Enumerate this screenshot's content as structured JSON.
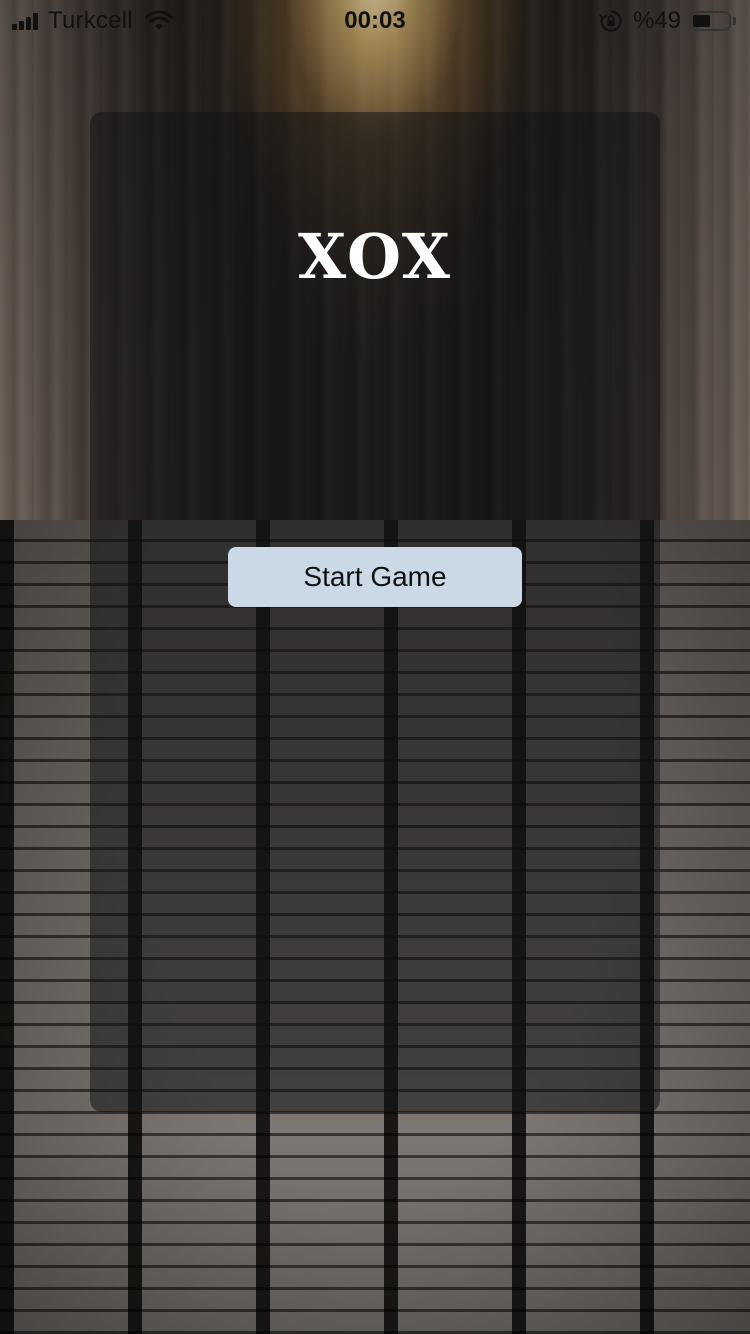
{
  "status_bar": {
    "carrier": "Turkcell",
    "time": "00:03",
    "battery_percent": "%49",
    "battery_level": 0.49,
    "signal_icon": "cellular-signal-icon",
    "wifi_icon": "wifi-icon",
    "rotation_lock_icon": "rotation-lock-icon",
    "battery_icon": "battery-icon"
  },
  "app": {
    "title": "XOX",
    "start_button_label": "Start Game"
  },
  "colors": {
    "card_overlay": "#141416",
    "button_background": "#cbd9e6",
    "title_text": "#ffffff"
  }
}
